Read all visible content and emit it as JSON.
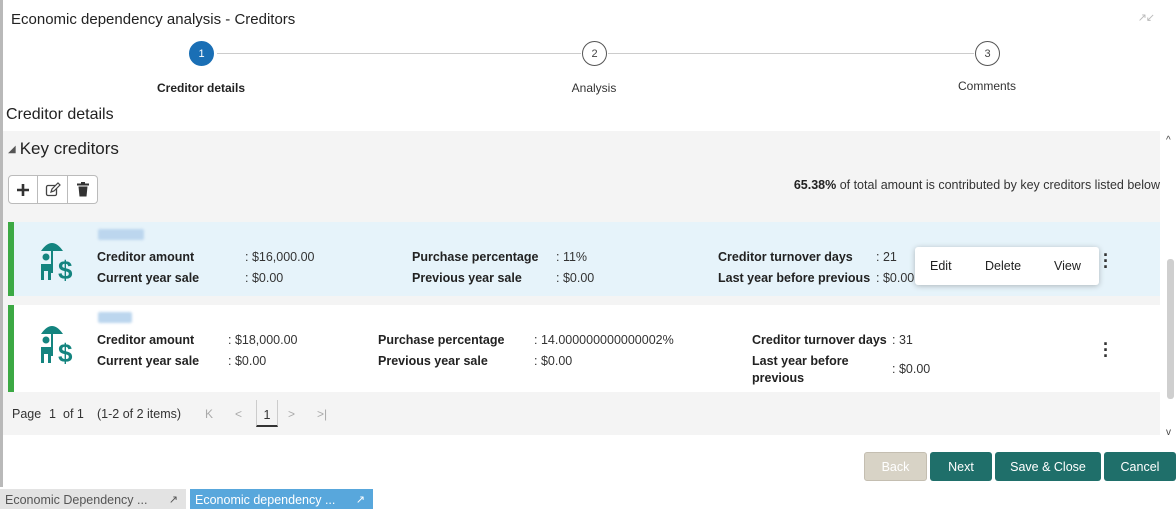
{
  "window": {
    "title": "Economic dependency analysis - Creditors"
  },
  "steps": [
    {
      "number": "1",
      "label": "Creditor details",
      "active": true
    },
    {
      "number": "2",
      "label": "Analysis",
      "active": false
    },
    {
      "number": "3",
      "label": "Comments",
      "active": false
    }
  ],
  "section_title": "Creditor details",
  "key_creditors": {
    "heading": "Key creditors",
    "contribution_pct": "65.38%",
    "contribution_text": " of total amount is contributed by key creditors listed below"
  },
  "toolbar": {
    "add": "add-icon",
    "edit": "edit-icon",
    "delete": "trash-icon"
  },
  "creditors": [
    {
      "creditor_amount_label": "Creditor amount",
      "creditor_amount": ": $16,000.00",
      "current_year_sale_label": "Current year sale",
      "current_year_sale": ": $0.00",
      "purchase_pct_label": "Purchase percentage",
      "purchase_pct": ": 11%",
      "prev_year_sale_label": "Previous year sale",
      "prev_year_sale": ": $0.00",
      "turnover_days_label": "Creditor turnover days",
      "turnover_days": ": 21",
      "last_year_label": "Last year before previous",
      "last_year": ": $0.00"
    },
    {
      "creditor_amount_label": "Creditor amount",
      "creditor_amount": ": $18,000.00",
      "current_year_sale_label": "Current year sale",
      "current_year_sale": ": $0.00",
      "purchase_pct_label": "Purchase percentage",
      "purchase_pct": ": 14.000000000000002%",
      "prev_year_sale_label": "Previous year sale",
      "prev_year_sale": ": $0.00",
      "turnover_days_label": "Creditor turnover days",
      "turnover_days": ": 31",
      "last_year_label_1": "Last year before",
      "last_year_label_2": "previous",
      "last_year": ": $0.00"
    }
  ],
  "context_menu": {
    "edit": "Edit",
    "delete": "Delete",
    "view": "View"
  },
  "pager": {
    "page_label": "Page",
    "page": "1",
    "of": "of 1",
    "items": "(1-2 of 2 items)",
    "current": "1"
  },
  "buttons": {
    "back": "Back",
    "next": "Next",
    "save_close": "Save & Close",
    "cancel": "Cancel"
  },
  "taskbar": [
    {
      "label": "Economic Dependency ..."
    },
    {
      "label": "Economic dependency ..."
    }
  ],
  "colors": {
    "accent": "#1a6fb5",
    "teal": "#1f6f6a",
    "green": "#3ca944",
    "selected_row": "#e6f3fa"
  }
}
